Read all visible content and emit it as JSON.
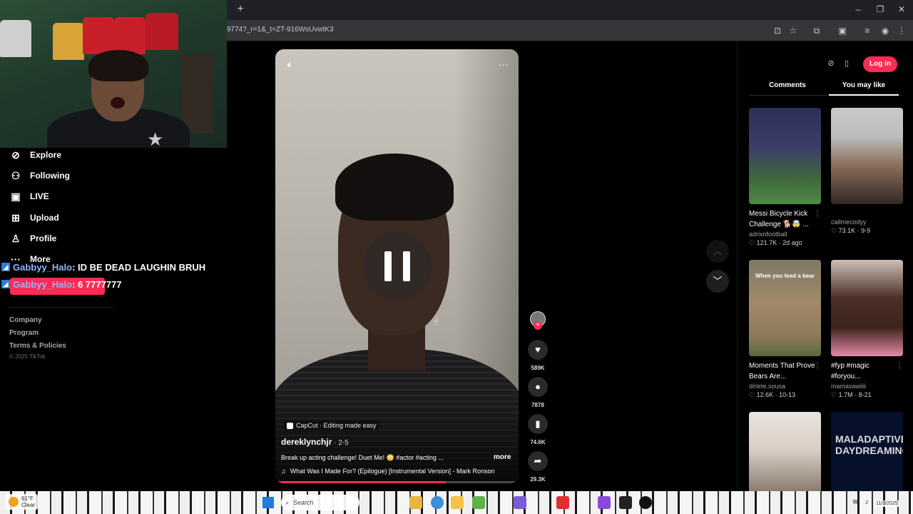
{
  "browser": {
    "new_tab": "+",
    "url": "9774?_r=1&_t=ZT-916WsUvwtK3",
    "window_minimize": "–",
    "window_restore": "❐",
    "window_close": "✕"
  },
  "sidebar": {
    "items": [
      {
        "label": "Explore",
        "icon": "compass-icon"
      },
      {
        "label": "Following",
        "icon": "following-icon"
      },
      {
        "label": "LIVE",
        "icon": "live-icon"
      },
      {
        "label": "Upload",
        "icon": "upload-icon"
      },
      {
        "label": "Profile",
        "icon": "profile-icon"
      },
      {
        "label": "More",
        "icon": "more-icon"
      }
    ],
    "footer": [
      "Company",
      "Program",
      "Terms & Policies"
    ],
    "copyright": "© 2025 TikTok"
  },
  "chat": [
    {
      "user": "Gabbyy_Halo",
      "message": ": ID BE DEAD LAUGHIN BRUH"
    },
    {
      "user": "Gabbyy_Halo",
      "message": ": 6 7777777"
    }
  ],
  "video": {
    "capcut": "CapCut · Editing made easy",
    "author": "dereklynchjr",
    "date": " · 2-5",
    "caption": "Break up acting challenge! Duet Me! 😳 #actor #acting ...",
    "more": "more",
    "music": "What Was I Made For? (Epilogue) [Instrumental Version] - Mark Ronson",
    "progress": 0.7
  },
  "actions": {
    "likes": "589K",
    "comments": "7878",
    "saves": "74.6K",
    "shares": "29.3K"
  },
  "right_panel": {
    "login": "Log in",
    "tabs": [
      "Comments",
      "You may like"
    ],
    "cards": [
      {
        "title": "Messi Bicycle Kick Challenge 🐕🤯 ...",
        "author": "adrixnfootball",
        "stats": "♡ 121.7K · 2d ago"
      },
      {
        "title": "",
        "author": "callmecodyy",
        "stats": "♡ 73.1K · 9-9"
      },
      {
        "title": "Moments That Prove Bears Are...",
        "author": "dirlete.sousa",
        "stats": "♡ 12.6K · 10-13",
        "overlay": "When you feed a bear"
      },
      {
        "title": "#fyp #magic #foryou...",
        "author": "mamasawiiii",
        "stats": "♡ 1.7M · 8-21"
      },
      {
        "title": "",
        "author": "",
        "stats": "",
        "overlay": ""
      },
      {
        "title": "",
        "author": "",
        "stats": "",
        "overlay": "MALADAPTIVE DAYDREAMING"
      }
    ]
  },
  "taskbar": {
    "temperature": "61°F",
    "condition": "Clear",
    "search": "Search",
    "date": "11/3/2025"
  },
  "colors": {
    "accent": "#fe2c55",
    "chat_user": "#8fb4ff"
  }
}
